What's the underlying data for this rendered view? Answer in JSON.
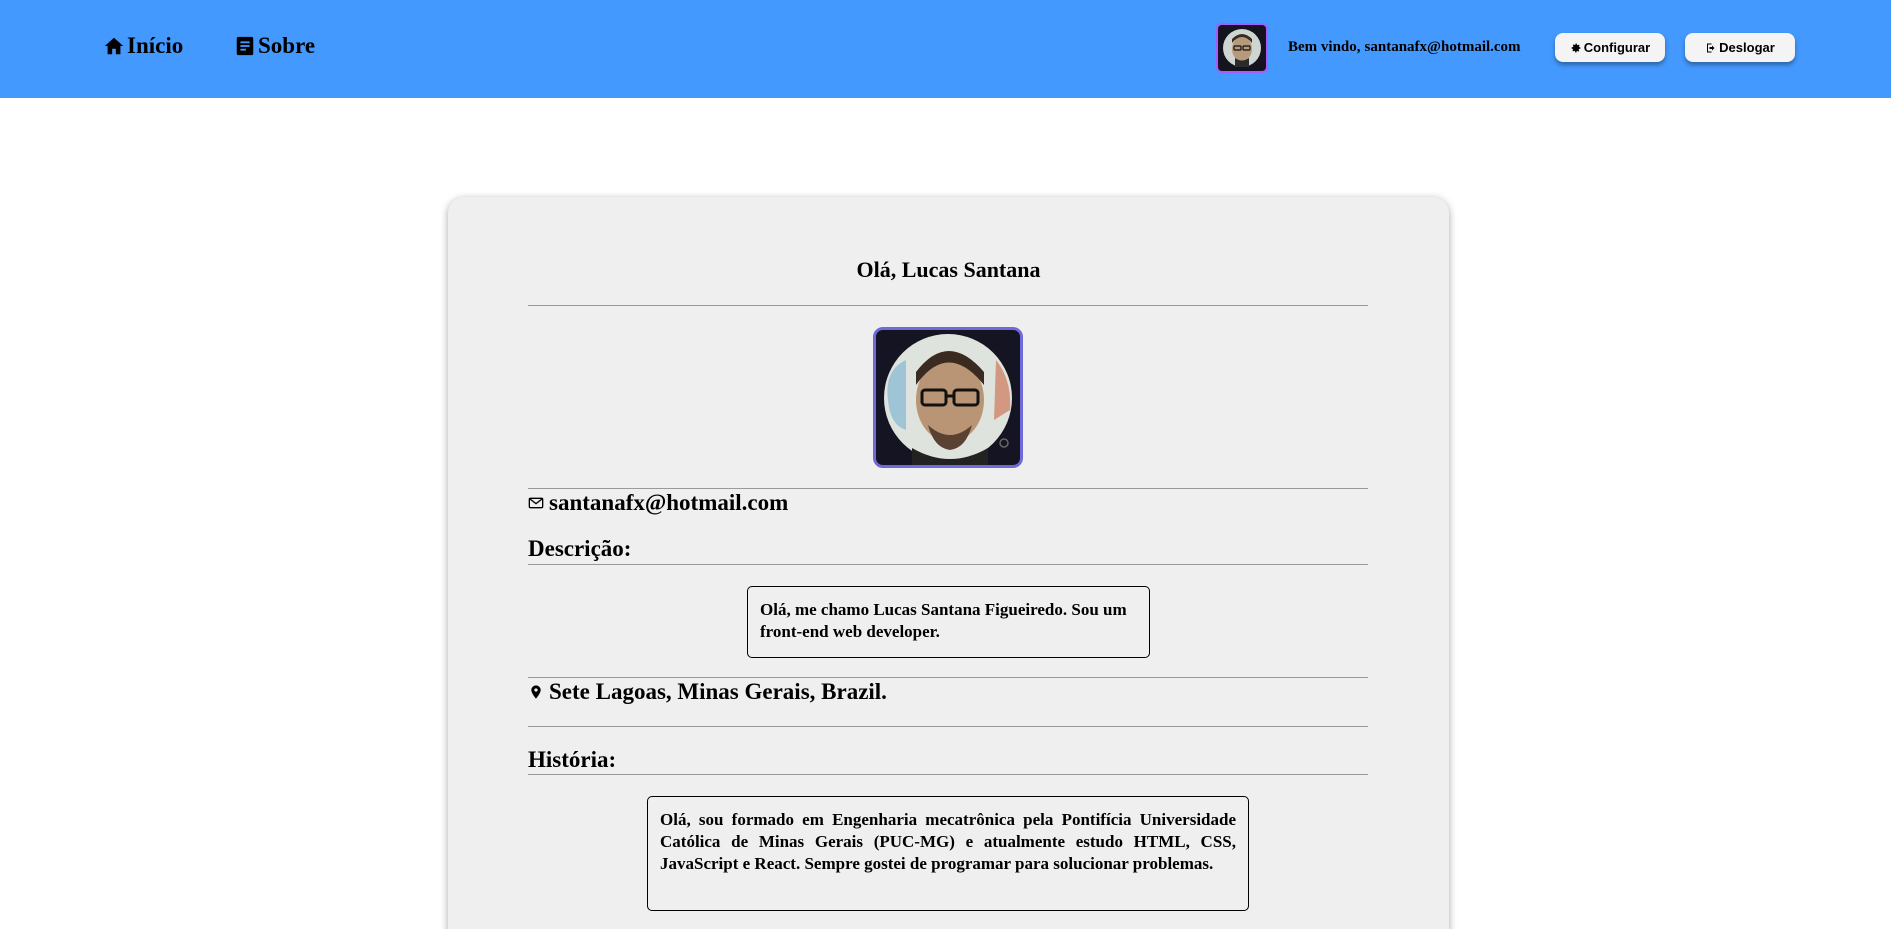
{
  "header": {
    "nav": [
      {
        "label": "Início",
        "icon": "home-icon"
      },
      {
        "label": "Sobre",
        "icon": "document-icon"
      }
    ],
    "welcome_prefix": "Bem vindo,",
    "welcome_email": "santanafx@hotmail.com",
    "config_label": "Configurar",
    "logout_label": "Deslogar",
    "colors": {
      "bar": "#4499ff",
      "button": "#f4f4f4"
    }
  },
  "profile": {
    "greeting": "Olá, Lucas Santana",
    "email": "santanafx@hotmail.com",
    "description_title": "Descrição:",
    "description": "Olá, me chamo Lucas Santana Figueiredo. Sou um front-end web developer.",
    "location": "Sete Lagoas, Minas Gerais, Brazil.",
    "history_title": "História:",
    "history": "Olá, sou formado em Engenharia mecatrônica pela Pontifícia Universidade Católica de Minas Gerais (PUC-MG) e atualmente estudo HTML, CSS, JavaScript e React. Sempre gostei de programar para solucionar problemas."
  }
}
